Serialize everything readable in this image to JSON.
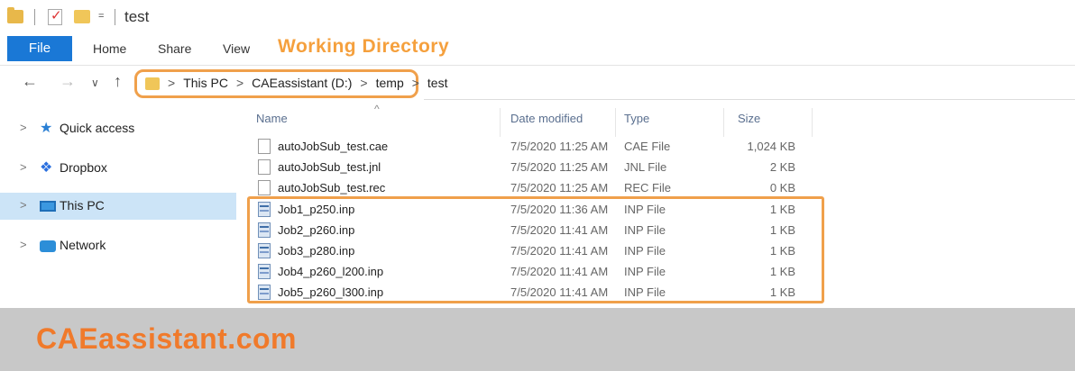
{
  "window": {
    "title": "test",
    "qat_arrow": "="
  },
  "ribbon": {
    "tabs": [
      {
        "label": "File"
      },
      {
        "label": "Home"
      },
      {
        "label": "Share"
      },
      {
        "label": "View"
      }
    ],
    "annotation": "Working Directory"
  },
  "address": {
    "crumbs": [
      "This PC",
      "CAEassistant (D:)",
      "temp",
      "test"
    ]
  },
  "nav": {
    "items": [
      {
        "label": "Quick access",
        "icon": "quick-access-star-icon",
        "selected": false
      },
      {
        "label": "Dropbox",
        "icon": "dropbox-icon",
        "selected": false
      },
      {
        "label": "This PC",
        "icon": "this-pc-icon",
        "selected": true
      },
      {
        "label": "Network",
        "icon": "network-icon",
        "selected": false
      }
    ]
  },
  "files": {
    "columns": {
      "name": "Name",
      "date": "Date modified",
      "type": "Type",
      "size": "Size"
    },
    "sort_indicator": "^",
    "rows": [
      {
        "name": "autoJobSub_test.cae",
        "date": "7/5/2020 11:25 AM",
        "type": "CAE File",
        "size": "1,024 KB",
        "icon": "cae-file-icon"
      },
      {
        "name": "autoJobSub_test.jnl",
        "date": "7/5/2020 11:25 AM",
        "type": "JNL File",
        "size": "2 KB",
        "icon": "jnl-file-icon"
      },
      {
        "name": "autoJobSub_test.rec",
        "date": "7/5/2020 11:25 AM",
        "type": "REC File",
        "size": "0 KB",
        "icon": "rec-file-icon"
      },
      {
        "name": "Job1_p250.inp",
        "date": "7/5/2020 11:36 AM",
        "type": "INP File",
        "size": "1 KB",
        "icon": "inp-file-icon"
      },
      {
        "name": "Job2_p260.inp",
        "date": "7/5/2020 11:41 AM",
        "type": "INP File",
        "size": "1 KB",
        "icon": "inp-file-icon"
      },
      {
        "name": "Job3_p280.inp",
        "date": "7/5/2020 11:41 AM",
        "type": "INP File",
        "size": "1 KB",
        "icon": "inp-file-icon"
      },
      {
        "name": "Job4_p260_l200.inp",
        "date": "7/5/2020 11:41 AM",
        "type": "INP File",
        "size": "1 KB",
        "icon": "inp-file-icon"
      },
      {
        "name": "Job5_p260_l300.inp",
        "date": "7/5/2020 11:41 AM",
        "type": "INP File",
        "size": "1 KB",
        "icon": "inp-file-icon"
      }
    ]
  },
  "footer": {
    "brand": "CAEassistant.com"
  },
  "colors": {
    "highlight": "#f0a04b",
    "file_tab": "#1a78d6",
    "brand": "#f07a2b",
    "selection": "#cce4f7"
  }
}
